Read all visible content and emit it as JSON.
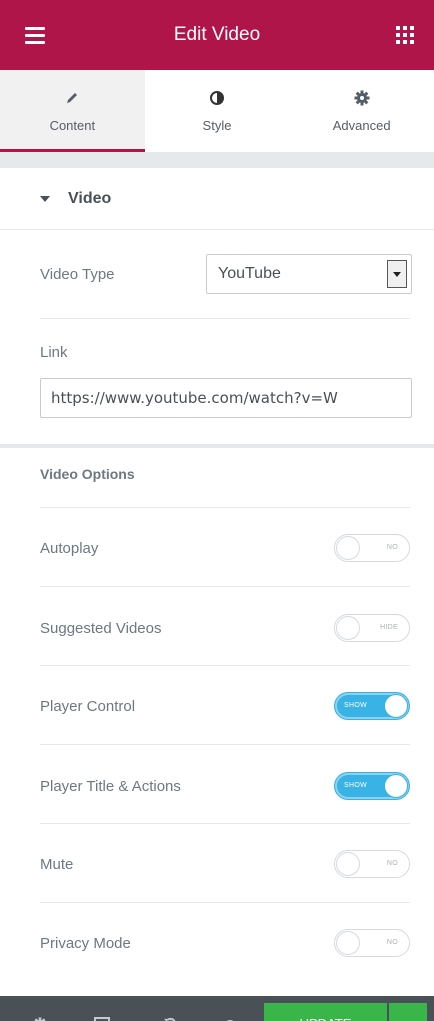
{
  "header": {
    "title": "Edit Video"
  },
  "tabs": [
    {
      "label": "Content",
      "icon": "pencil-icon",
      "active": true
    },
    {
      "label": "Style",
      "icon": "half-circle-icon",
      "active": false
    },
    {
      "label": "Advanced",
      "icon": "gear-icon",
      "active": false
    }
  ],
  "section": {
    "title": "Video"
  },
  "video_type": {
    "label": "Video Type",
    "value": "YouTube"
  },
  "link": {
    "label": "Link",
    "value": "https://www.youtube.com/watch?v=W"
  },
  "options": {
    "heading": "Video Options",
    "items": [
      {
        "label": "Autoplay",
        "state": "NO",
        "on": false
      },
      {
        "label": "Suggested Videos",
        "state": "HIDE",
        "on": false
      },
      {
        "label": "Player Control",
        "state": "SHOW",
        "on": true
      },
      {
        "label": "Player Title & Actions",
        "state": "SHOW",
        "on": true
      },
      {
        "label": "Mute",
        "state": "NO",
        "on": false
      },
      {
        "label": "Privacy Mode",
        "state": "NO",
        "on": false
      }
    ]
  },
  "footer": {
    "update_label": "UPDATE"
  },
  "colors": {
    "brand": "#b0154a",
    "toggle_on": "#39b3e5",
    "update": "#39b54a",
    "footer_bg": "#495157"
  }
}
